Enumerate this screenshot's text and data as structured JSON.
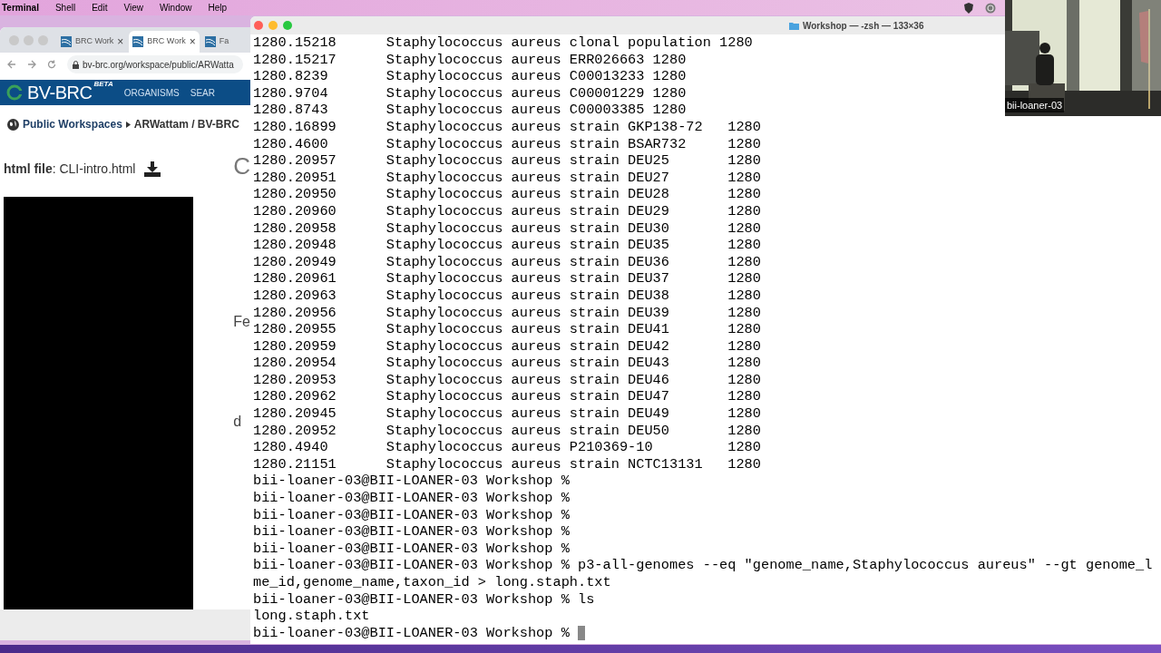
{
  "menu_bar": {
    "app": "Terminal",
    "items": [
      "Shell",
      "Edit",
      "View",
      "Window",
      "Help"
    ]
  },
  "browser": {
    "tabs": [
      {
        "label": "BRC Work",
        "selected": false,
        "close": "×"
      },
      {
        "label": "BRC Work",
        "selected": true,
        "close": "×"
      },
      {
        "label": "Fa",
        "selected": false
      }
    ],
    "url": "bv-brc.org/workspace/public/ARWatta",
    "logo": "BV-BRC",
    "logo_badge": "BETA",
    "nav": [
      "ORGANISMS",
      "SEAR"
    ],
    "breadcrumb": [
      "Public Workspaces",
      "ARWattam / BV-BRC"
    ],
    "file_label": "**html file**: CLI-intro.html",
    "partial_texts": [
      "C",
      "Fe",
      "d"
    ]
  },
  "terminal": {
    "title": "Workshop — -zsh — 133×36",
    "lines": [
      {
        "kind": "row",
        "id": "1280.15218",
        "rest": "Staphylococcus aureus clonal population 1280"
      },
      {
        "kind": "row",
        "id": "1280.15217",
        "rest": "Staphylococcus aureus ERR026663 1280"
      },
      {
        "kind": "row",
        "id": "1280.8239",
        "rest": "Staphylococcus aureus C00013233 1280"
      },
      {
        "kind": "row",
        "id": "1280.9704",
        "rest": "Staphylococcus aureus C00001229 1280"
      },
      {
        "kind": "row",
        "id": "1280.8743",
        "rest": "Staphylococcus aureus C00003385 1280"
      },
      {
        "kind": "row",
        "id": "1280.16899",
        "rest": "Staphylococcus aureus strain GKP138-72   1280"
      },
      {
        "kind": "row",
        "id": "1280.4600",
        "rest": "Staphylococcus aureus strain BSAR732     1280"
      },
      {
        "kind": "row",
        "id": "1280.20957",
        "rest": "Staphylococcus aureus strain DEU25       1280"
      },
      {
        "kind": "row",
        "id": "1280.20951",
        "rest": "Staphylococcus aureus strain DEU27       1280"
      },
      {
        "kind": "row",
        "id": "1280.20950",
        "rest": "Staphylococcus aureus strain DEU28       1280"
      },
      {
        "kind": "row",
        "id": "1280.20960",
        "rest": "Staphylococcus aureus strain DEU29       1280"
      },
      {
        "kind": "row",
        "id": "1280.20958",
        "rest": "Staphylococcus aureus strain DEU30       1280"
      },
      {
        "kind": "row",
        "id": "1280.20948",
        "rest": "Staphylococcus aureus strain DEU35       1280"
      },
      {
        "kind": "row",
        "id": "1280.20949",
        "rest": "Staphylococcus aureus strain DEU36       1280"
      },
      {
        "kind": "row",
        "id": "1280.20961",
        "rest": "Staphylococcus aureus strain DEU37       1280"
      },
      {
        "kind": "row",
        "id": "1280.20963",
        "rest": "Staphylococcus aureus strain DEU38       1280"
      },
      {
        "kind": "row",
        "id": "1280.20956",
        "rest": "Staphylococcus aureus strain DEU39       1280"
      },
      {
        "kind": "row",
        "id": "1280.20955",
        "rest": "Staphylococcus aureus strain DEU41       1280"
      },
      {
        "kind": "row",
        "id": "1280.20959",
        "rest": "Staphylococcus aureus strain DEU42       1280"
      },
      {
        "kind": "row",
        "id": "1280.20954",
        "rest": "Staphylococcus aureus strain DEU43       1280"
      },
      {
        "kind": "row",
        "id": "1280.20953",
        "rest": "Staphylococcus aureus strain DEU46       1280"
      },
      {
        "kind": "row",
        "id": "1280.20962",
        "rest": "Staphylococcus aureus strain DEU47       1280"
      },
      {
        "kind": "row",
        "id": "1280.20945",
        "rest": "Staphylococcus aureus strain DEU49       1280"
      },
      {
        "kind": "row",
        "id": "1280.20952",
        "rest": "Staphylococcus aureus strain DEU50       1280"
      },
      {
        "kind": "row",
        "id": "1280.4940",
        "rest": "Staphylococcus aureus P210369-10         1280"
      },
      {
        "kind": "row",
        "id": "1280.21151",
        "rest": "Staphylococcus aureus strain NCTC13131   1280"
      },
      {
        "kind": "text",
        "text": "bii-loaner-03@BII-LOANER-03 Workshop %"
      },
      {
        "kind": "text",
        "text": "bii-loaner-03@BII-LOANER-03 Workshop %"
      },
      {
        "kind": "text",
        "text": "bii-loaner-03@BII-LOANER-03 Workshop %"
      },
      {
        "kind": "text",
        "text": "bii-loaner-03@BII-LOANER-03 Workshop %"
      },
      {
        "kind": "text",
        "text": "bii-loaner-03@BII-LOANER-03 Workshop %"
      },
      {
        "kind": "text",
        "text": "bii-loaner-03@BII-LOANER-03 Workshop % p3-all-genomes --eq \"genome_name,Staphylococcus aureus\" --gt genome_l"
      },
      {
        "kind": "text",
        "text": "me_id,genome_name,taxon_id > long.staph.txt"
      },
      {
        "kind": "text",
        "text": "bii-loaner-03@BII-LOANER-03 Workshop % ls"
      },
      {
        "kind": "text",
        "text": "long.staph.txt"
      },
      {
        "kind": "prompt",
        "text": "bii-loaner-03@BII-LOANER-03 Workshop %"
      }
    ]
  },
  "video": {
    "kind": "picture",
    "name": "bii-loaner-03"
  }
}
